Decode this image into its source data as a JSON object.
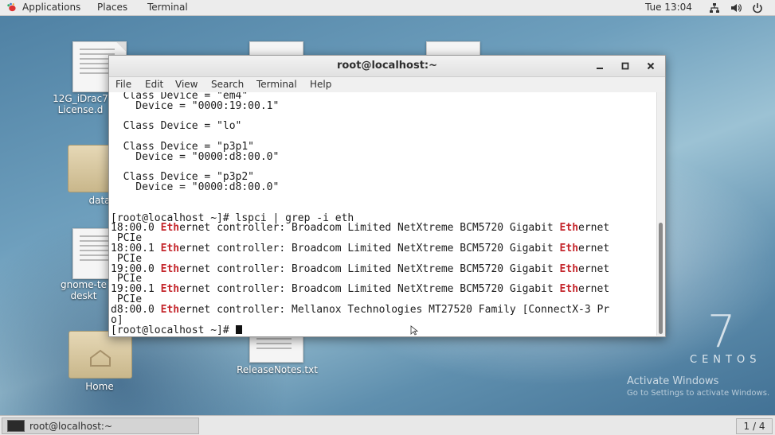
{
  "topbar": {
    "applications": "Applications",
    "places": "Places",
    "terminal": "Terminal",
    "clock": "Tue 13:04",
    "tray_icons": [
      "network-icon",
      "volume-icon",
      "power-icon"
    ]
  },
  "desktop": {
    "icons": [
      {
        "label": "12G_iDrac7 License.d"
      },
      {
        "label": "data"
      },
      {
        "label": "gnome-te deskt"
      },
      {
        "label": "Home"
      },
      {
        "label": "ReleaseNotes.txt"
      }
    ],
    "watermark_number": "7",
    "watermark_text": "CENTOS",
    "activate_title": "Activate Windows",
    "activate_sub": "Go to Settings to activate Windows."
  },
  "window": {
    "title": "root@localhost:~",
    "menu": [
      "File",
      "Edit",
      "View",
      "Search",
      "Terminal",
      "Help"
    ],
    "terminal_lines": [
      [
        {
          "t": "  Class Device = \"em4\""
        }
      ],
      [
        {
          "t": "    Device = \"0000:19:00.1\""
        }
      ],
      [
        {
          "t": ""
        }
      ],
      [
        {
          "t": "  Class Device = \"lo\""
        }
      ],
      [
        {
          "t": ""
        }
      ],
      [
        {
          "t": "  Class Device = \"p3p1\""
        }
      ],
      [
        {
          "t": "    Device = \"0000:d8:00.0\""
        }
      ],
      [
        {
          "t": ""
        }
      ],
      [
        {
          "t": "  Class Device = \"p3p2\""
        }
      ],
      [
        {
          "t": "    Device = \"0000:d8:00.0\""
        }
      ],
      [
        {
          "t": ""
        }
      ],
      [
        {
          "t": ""
        }
      ],
      [
        {
          "t": "[root@localhost ~]# lspci | grep -i eth"
        }
      ],
      [
        {
          "t": "18:00.0 "
        },
        {
          "t": "Eth",
          "hl": true
        },
        {
          "t": "ernet controller: Broadcom Limited NetXtreme BCM5720 Gigabit "
        },
        {
          "t": "Eth",
          "hl": true
        },
        {
          "t": "ernet"
        }
      ],
      [
        {
          "t": " PCIe"
        }
      ],
      [
        {
          "t": "18:00.1 "
        },
        {
          "t": "Eth",
          "hl": true
        },
        {
          "t": "ernet controller: Broadcom Limited NetXtreme BCM5720 Gigabit "
        },
        {
          "t": "Eth",
          "hl": true
        },
        {
          "t": "ernet"
        }
      ],
      [
        {
          "t": " PCIe"
        }
      ],
      [
        {
          "t": "19:00.0 "
        },
        {
          "t": "Eth",
          "hl": true
        },
        {
          "t": "ernet controller: Broadcom Limited NetXtreme BCM5720 Gigabit "
        },
        {
          "t": "Eth",
          "hl": true
        },
        {
          "t": "ernet"
        }
      ],
      [
        {
          "t": " PCIe"
        }
      ],
      [
        {
          "t": "19:00.1 "
        },
        {
          "t": "Eth",
          "hl": true
        },
        {
          "t": "ernet controller: Broadcom Limited NetXtreme BCM5720 Gigabit "
        },
        {
          "t": "Eth",
          "hl": true
        },
        {
          "t": "ernet"
        }
      ],
      [
        {
          "t": " PCIe"
        }
      ],
      [
        {
          "t": "d8:00.0 "
        },
        {
          "t": "Eth",
          "hl": true
        },
        {
          "t": "ernet controller: Mellanox Technologies MT27520 Family [ConnectX-3 Pr"
        }
      ],
      [
        {
          "t": "o]"
        }
      ],
      [
        {
          "t": "[root@localhost ~]# "
        },
        {
          "cursor": true
        }
      ]
    ]
  },
  "taskbar": {
    "item": "root@localhost:~",
    "pager": "1 / 4"
  },
  "colors": {
    "highlight": "#c4252b",
    "topbar": "#ececec"
  }
}
